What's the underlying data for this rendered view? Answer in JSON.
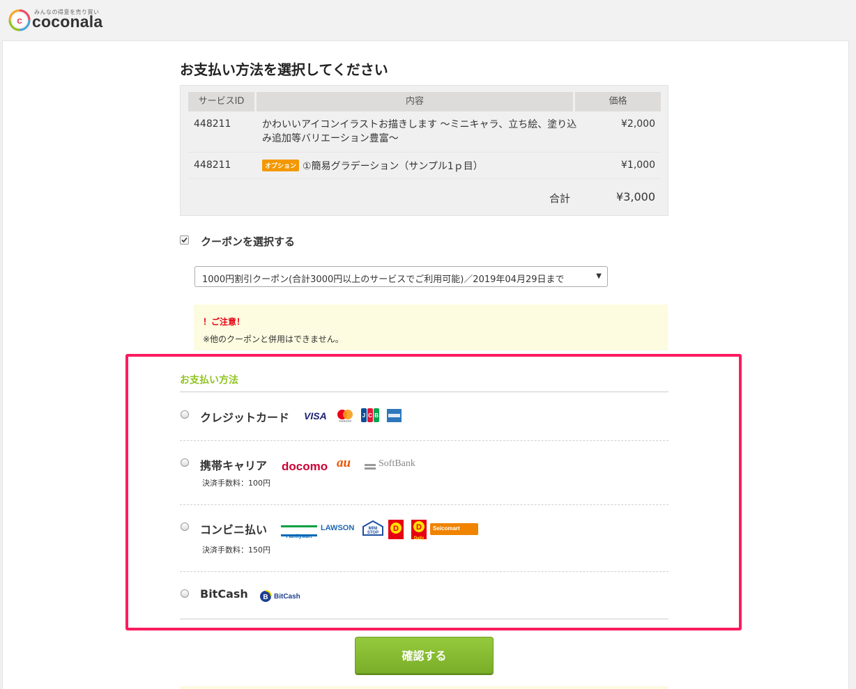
{
  "header": {
    "tagline": "みんなの得意を売り買い",
    "logo_text": "coconala"
  },
  "page_title": "お支払い方法を選択してください",
  "order_table": {
    "headers": {
      "id": "サービスID",
      "content": "内容",
      "price": "価格"
    },
    "rows": [
      {
        "id": "448211",
        "description": "かわいいアイコンイラストお描きします 〜ミニキャラ、立ち絵、塗り込み追加等バリエーション豊富〜",
        "price": "¥2,000"
      },
      {
        "id": "448211",
        "badge": "オプション",
        "description": "①簡易グラデーション（サンプル1ｐ目）",
        "price": "¥1,000"
      }
    ],
    "total_label": "合計",
    "total_value": "¥3,000"
  },
  "coupon": {
    "checked": true,
    "label": "クーポンを選択する",
    "selected_option": "1000円割引クーポン(合計3000円以上のサービスでご利用可能)／2019年04月29日まで"
  },
  "notice": {
    "title": "！ご注意！",
    "text": "※他のクーポンと併用はできません。"
  },
  "payment": {
    "title": "お支払い方法",
    "methods": [
      {
        "label": "クレジットカード",
        "fee": "",
        "brands": [
          "VISA",
          "mastercard",
          "JCB",
          "AMEX"
        ]
      },
      {
        "label": "携帯キャリア",
        "fee": "決済手数料：100円",
        "brands": [
          "docomo",
          "au",
          "SoftBank"
        ]
      },
      {
        "label": "コンビニ払い",
        "fee": "決済手数料：150円",
        "brands": [
          "FamilyMart",
          "LAWSON",
          "MINI STOP",
          "ヤマザキ",
          "Daily",
          "Seicomart"
        ]
      },
      {
        "label": "BitCash",
        "fee": "",
        "brands": [
          "BitCash"
        ]
      }
    ]
  },
  "brand_text": {
    "visa": "VISA",
    "docomo": "docomo",
    "au": "au",
    "softbank": "SoftBank",
    "familymart": "FamilyMart",
    "lawson": "LAWSON",
    "ministop": "MINI STOP",
    "daily": "Daily",
    "seicomart": "Seicomart",
    "bitcash": "BitCash"
  },
  "confirm_button": "確認する",
  "colors": {
    "accent_green": "#8fc31f",
    "highlight_pink": "#fb1b5f",
    "option_orange": "#f39800",
    "notice_red": "#e60012"
  }
}
